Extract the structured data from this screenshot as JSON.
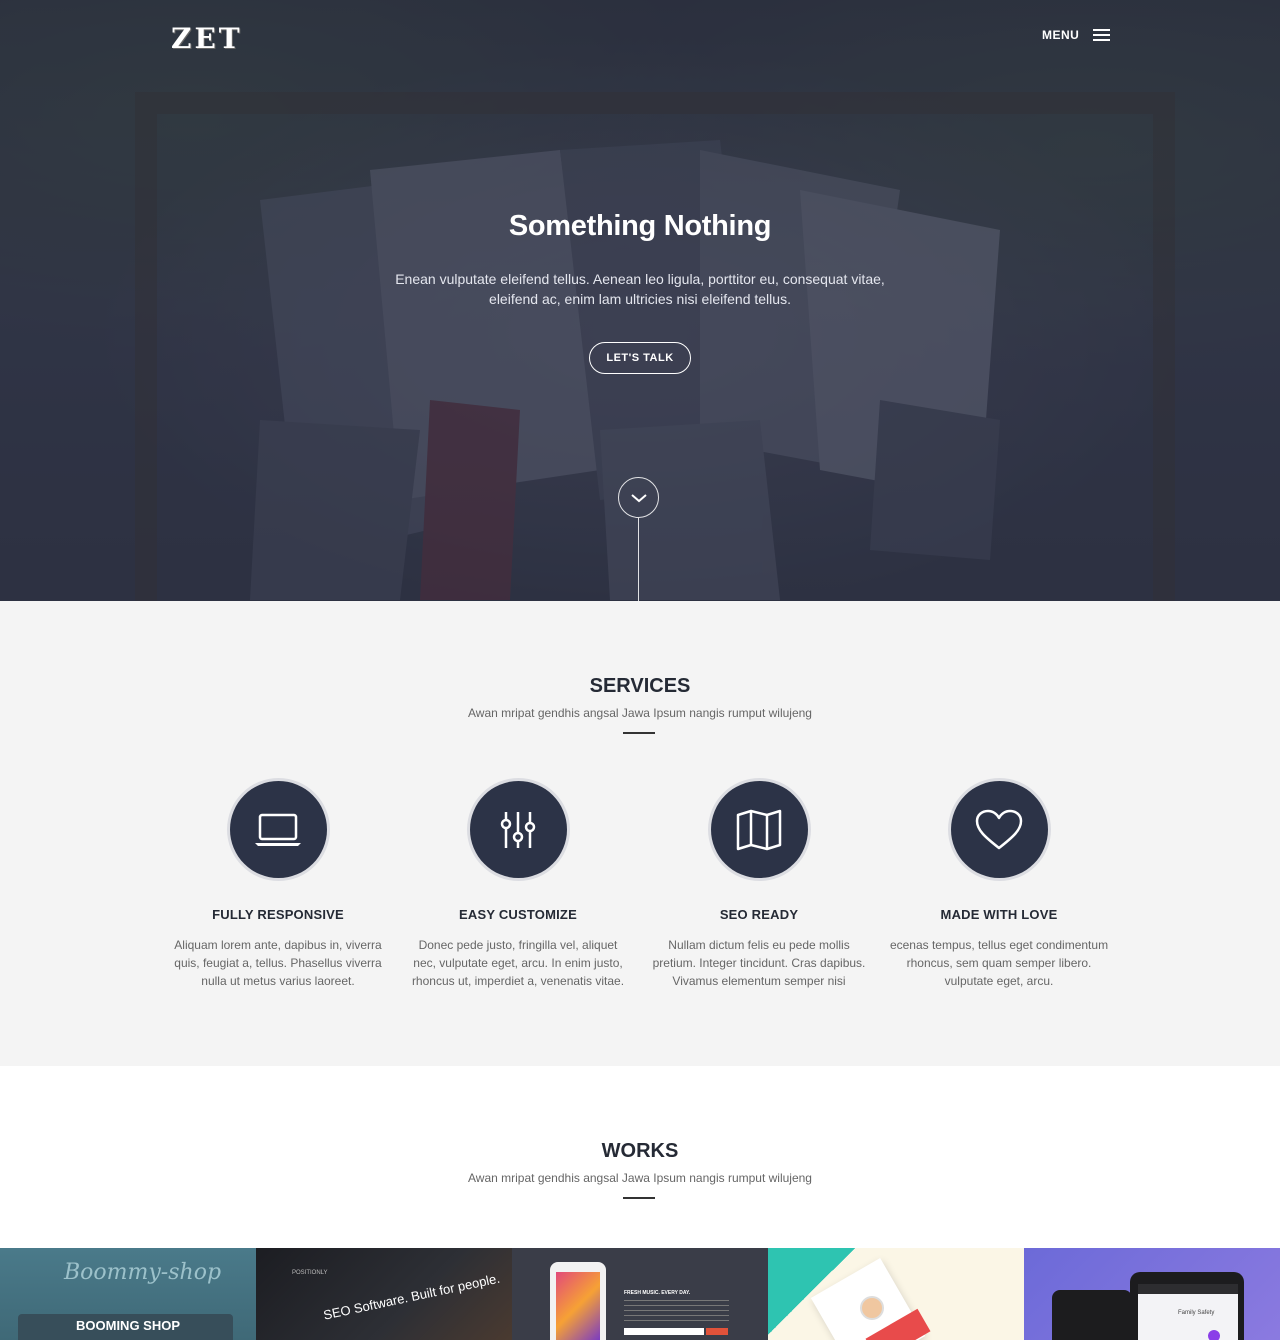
{
  "header": {
    "logo": "ZET",
    "menu_label": "MENU"
  },
  "hero": {
    "title": "Something Nothing",
    "text": "Enean vulputate eleifend tellus. Aenean leo ligula, porttitor eu, consequat vitae, eleifend ac, enim lam ultricies nisi eleifend tellus.",
    "cta_label": "LET'S TALK"
  },
  "services": {
    "title": "SERVICES",
    "subtitle": "Awan mripat gendhis angsal Jawa Ipsum nangis rumput wilujeng",
    "items": [
      {
        "icon": "laptop-icon",
        "title": "FULLY RESPONSIVE",
        "text": "Aliquam lorem ante, dapibus in, viverra quis, feugiat a, tellus. Phasellus viverra nulla ut metus varius laoreet."
      },
      {
        "icon": "sliders-icon",
        "title": "EASY CUSTOMIZE",
        "text": "Donec pede justo, fringilla vel, aliquet nec, vulputate eget, arcu. In enim justo, rhoncus ut, imperdiet a, venenatis vitae."
      },
      {
        "icon": "map-icon",
        "title": "SEO READY",
        "text": "Nullam dictum felis eu pede mollis pretium. Integer tincidunt. Cras dapibus. Vivamus elementum semper nisi"
      },
      {
        "icon": "heart-icon",
        "title": "MADE WITH LOVE",
        "text": "ecenas tempus, tellus eget condimentum rhoncus, sem quam semper libero. vulputate eget, arcu."
      }
    ]
  },
  "works": {
    "title": "WORKS",
    "subtitle": "Awan mripat gendhis angsal Jawa Ipsum nangis rumput wilujeng",
    "items": [
      {
        "script": "Boommy-shop",
        "label": "BOOMING SHOP"
      },
      {
        "brand": "POSITIONLY",
        "headline": "SEO Software. Built for people."
      },
      {
        "text": "FRESH MUSIC. EVERY DAY."
      },
      {},
      {
        "label": "Family Safety"
      }
    ]
  },
  "colors": {
    "hero_overlay": "#2c3040",
    "service_circle": "#2c3347",
    "heading": "#252a35",
    "section_bg": "#f4f4f4"
  }
}
